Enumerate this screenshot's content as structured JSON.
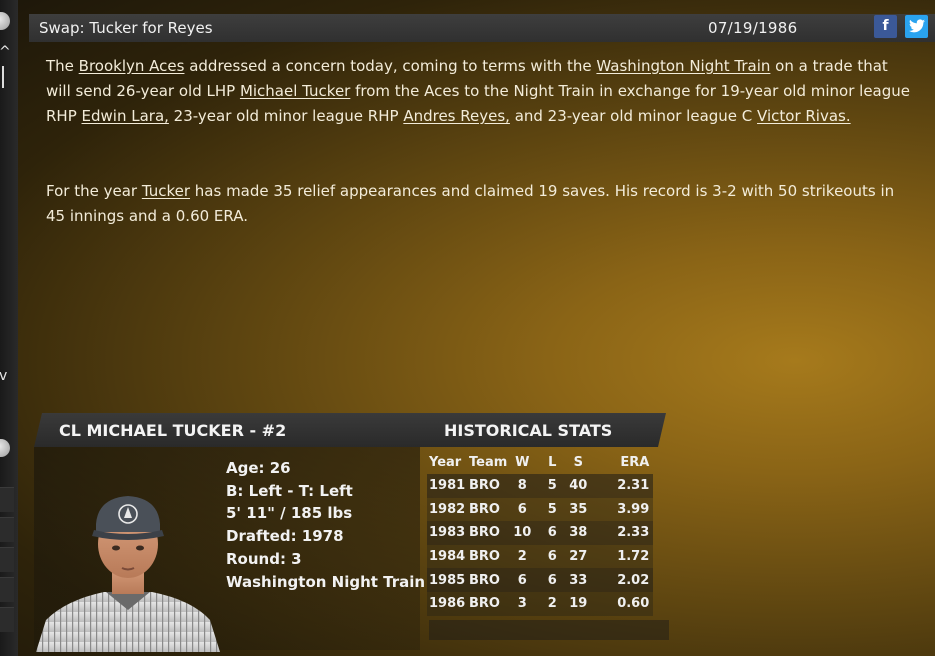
{
  "header": {
    "title": "Swap: Tucker for Reyes",
    "date": "07/19/1986",
    "facebook_icon": "f",
    "twitter_icon": "🐦"
  },
  "article": {
    "p1": {
      "t1": "The ",
      "team1": "Brooklyn Aces",
      "t2": " addressed a concern today, coming to terms with the ",
      "team2": "Washington Night Train",
      "t3": " on a trade that will send 26-year old LHP ",
      "player1": "Michael Tucker",
      "t4": " from the Aces to the Night Train in exchange for 19-year old minor league RHP ",
      "player2": "Edwin Lara,",
      "t5": " 23-year old minor league RHP ",
      "player3": "Andres Reyes,",
      "t6": " and 23-year old minor league C ",
      "player4": "Victor Rivas."
    },
    "p2": {
      "t1": "For the year ",
      "player": "Tucker",
      "t2": " has made 35 relief appearances and claimed 19 saves. His record is 3-2 with 50 strikeouts in 45 innings and a 0.60 ERA."
    }
  },
  "player": {
    "header": "CL MICHAEL TUCKER - #2",
    "age": "Age: 26",
    "bats_throws": "B: Left - T: Left",
    "height_weight": "5' 11\" / 185 lbs",
    "drafted": "Drafted: 1978",
    "round": "Round: 3",
    "team": "Washington Night Train"
  },
  "stats": {
    "title": "HISTORICAL STATS",
    "columns": [
      "Year",
      "Team",
      "W",
      "L",
      "S",
      "ERA"
    ],
    "rows": [
      [
        "1981",
        "BRO",
        "8",
        "5",
        "40",
        "2.31"
      ],
      [
        "1982",
        "BRO",
        "6",
        "5",
        "35",
        "3.99"
      ],
      [
        "1983",
        "BRO",
        "10",
        "6",
        "38",
        "2.33"
      ],
      [
        "1984",
        "BRO",
        "2",
        "6",
        "27",
        "1.72"
      ],
      [
        "1985",
        "BRO",
        "6",
        "6",
        "33",
        "2.02"
      ],
      [
        "1986",
        "BRO",
        "3",
        "2",
        "19",
        "0.60"
      ]
    ]
  },
  "rail": {
    "up_arrow": "^",
    "down_arrow": "v"
  }
}
